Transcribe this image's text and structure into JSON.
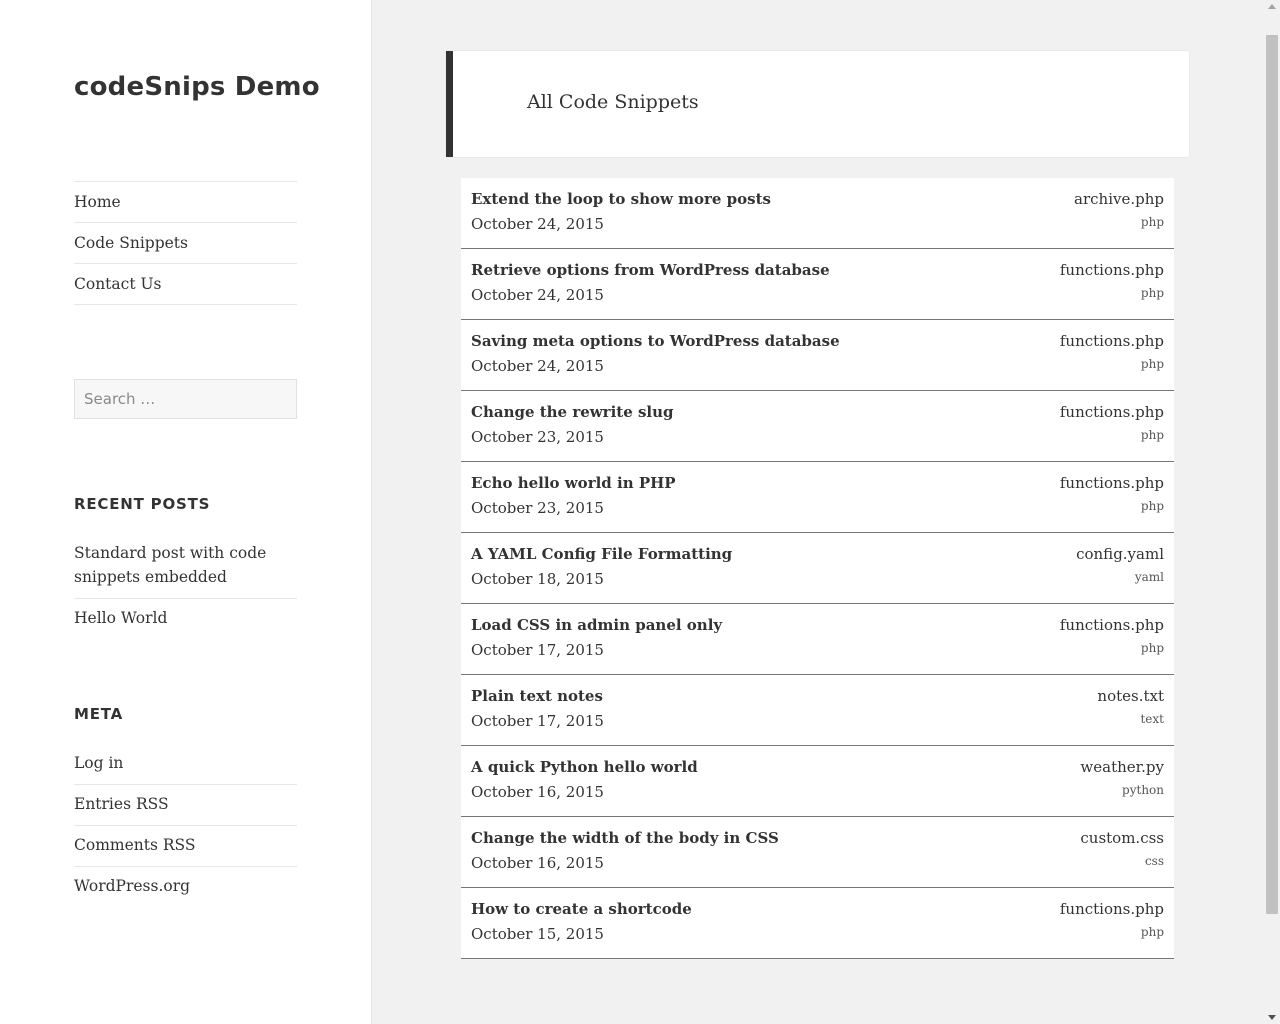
{
  "site": {
    "title": "codeSnips Demo"
  },
  "nav": {
    "items": [
      {
        "label": "Home"
      },
      {
        "label": "Code Snippets"
      },
      {
        "label": "Contact Us"
      }
    ]
  },
  "search": {
    "placeholder": "Search …",
    "value": ""
  },
  "recent_posts": {
    "heading": "Recent Posts",
    "items": [
      {
        "label": "Standard post with code snippets embedded"
      },
      {
        "label": "Hello World"
      }
    ]
  },
  "meta": {
    "heading": "Meta",
    "items": [
      {
        "label": "Log in"
      },
      {
        "label": "Entries RSS"
      },
      {
        "label": "Comments RSS"
      },
      {
        "label": "WordPress.org"
      }
    ]
  },
  "main": {
    "page_title": "All Code Snippets",
    "snippets": [
      {
        "title": "Extend the loop to show more posts",
        "date": "October 24, 2015",
        "file": "archive.php",
        "lang": "php"
      },
      {
        "title": "Retrieve options from WordPress database",
        "date": "October 24, 2015",
        "file": "functions.php",
        "lang": "php"
      },
      {
        "title": "Saving meta options to WordPress database",
        "date": "October 24, 2015",
        "file": "functions.php",
        "lang": "php"
      },
      {
        "title": "Change the rewrite slug",
        "date": "October 23, 2015",
        "file": "functions.php",
        "lang": "php"
      },
      {
        "title": "Echo hello world in PHP",
        "date": "October 23, 2015",
        "file": "functions.php",
        "lang": "php"
      },
      {
        "title": "A YAML Config File Formatting",
        "date": "October 18, 2015",
        "file": "config.yaml",
        "lang": "yaml"
      },
      {
        "title": "Load CSS in admin panel only",
        "date": "October 17, 2015",
        "file": "functions.php",
        "lang": "php"
      },
      {
        "title": "Plain text notes",
        "date": "October 17, 2015",
        "file": "notes.txt",
        "lang": "text"
      },
      {
        "title": "A quick Python hello world",
        "date": "October 16, 2015",
        "file": "weather.py",
        "lang": "python"
      },
      {
        "title": "Change the width of the body in CSS",
        "date": "October 16, 2015",
        "file": "custom.css",
        "lang": "css"
      },
      {
        "title": "How to create a shortcode",
        "date": "October 15, 2015",
        "file": "functions.php",
        "lang": "php"
      }
    ]
  }
}
